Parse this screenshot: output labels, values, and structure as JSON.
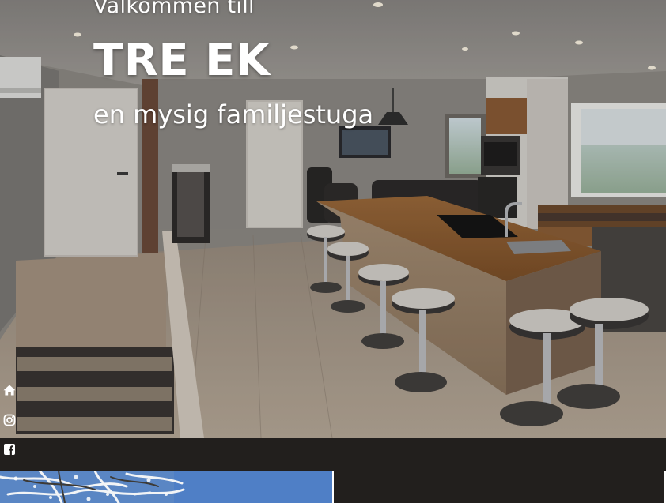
{
  "hero": {
    "greeting": "Välkommen till",
    "title": "TRE EK",
    "subtitle": "en mysig familjestuga"
  },
  "social": [
    {
      "icon": "home-icon"
    },
    {
      "icon": "instagram-icon"
    },
    {
      "icon": "facebook-icon"
    }
  ],
  "colors": {
    "text": "#ffffff",
    "dark_bar": "#221f1d",
    "sky": "#5a86c4"
  }
}
